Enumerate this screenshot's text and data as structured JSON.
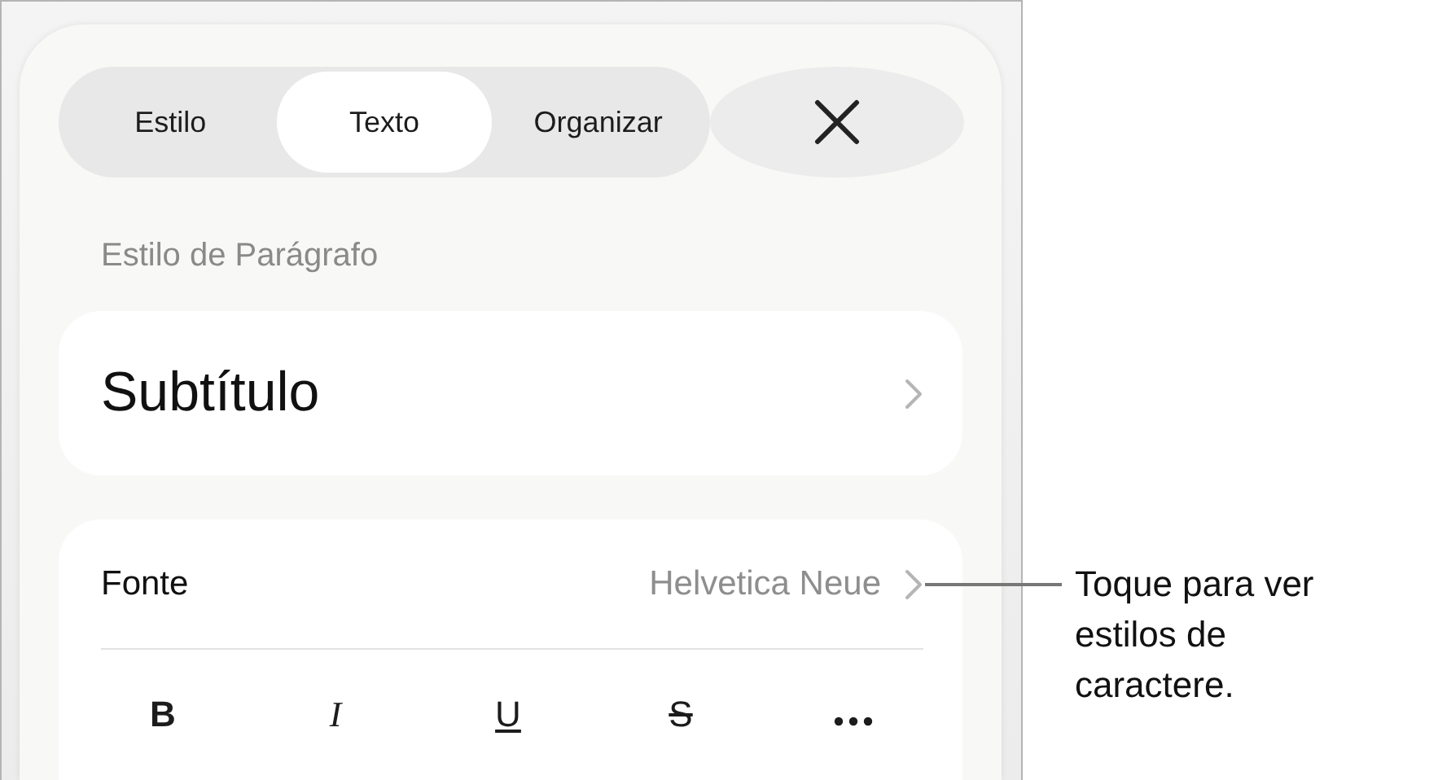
{
  "tabs": [
    {
      "label": "Estilo",
      "selected": false
    },
    {
      "label": "Texto",
      "selected": true
    },
    {
      "label": "Organizar",
      "selected": false
    }
  ],
  "section_heading": "Estilo de Parágrafo",
  "paragraph_style": {
    "value": "Subtítulo"
  },
  "font": {
    "label": "Fonte",
    "value": "Helvetica Neue"
  },
  "format_buttons": [
    {
      "kind": "bold",
      "label": "B"
    },
    {
      "kind": "italic",
      "label": "I"
    },
    {
      "kind": "underline",
      "label": "U"
    },
    {
      "kind": "strikethrough",
      "label": "S"
    },
    {
      "kind": "more"
    }
  ],
  "callout": {
    "text": "Toque para ver estilos de caractere."
  }
}
